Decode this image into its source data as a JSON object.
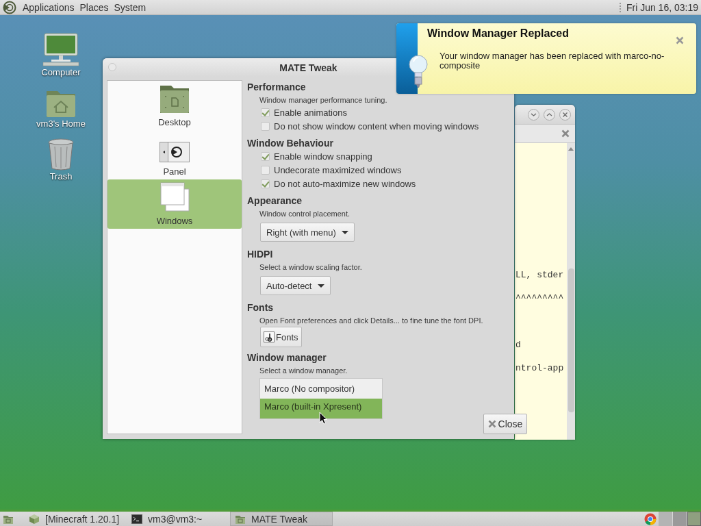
{
  "top_panel": {
    "menus": [
      "Applications",
      "Places",
      "System"
    ],
    "clock": "Fri Jun 16, 03:19"
  },
  "desktop_icons": [
    {
      "label": "Computer",
      "kind": "computer"
    },
    {
      "label": "vm3's Home",
      "kind": "home"
    },
    {
      "label": "Trash",
      "kind": "trash"
    }
  ],
  "background_window": {
    "text_lines": [
      "LL, stder",
      "^^^^^^^^^",
      "d",
      "ntrol-app"
    ]
  },
  "tweak_window": {
    "title": "MATE Tweak",
    "sidebar": [
      {
        "label": "Desktop",
        "kind": "desktop",
        "selected": false
      },
      {
        "label": "Panel",
        "kind": "panel",
        "selected": false
      },
      {
        "label": "Windows",
        "kind": "windows",
        "selected": true
      }
    ],
    "sections": [
      {
        "heading": "Performance",
        "description": "Window manager performance tuning.",
        "kind": "checks",
        "options": [
          {
            "label": "Enable animations",
            "checked": true
          },
          {
            "label": "Do not show window content when moving windows",
            "checked": false
          }
        ]
      },
      {
        "heading": "Window Behaviour",
        "kind": "checks",
        "options": [
          {
            "label": "Enable window snapping",
            "checked": true
          },
          {
            "label": "Undecorate maximized windows",
            "checked": false
          },
          {
            "label": "Do not auto-maximize new windows",
            "checked": true
          }
        ]
      },
      {
        "heading": "Appearance",
        "description": "Window control placement.",
        "kind": "dropdown",
        "value": "Right (with menu)"
      },
      {
        "heading": "HIDPI",
        "description": "Select a window scaling factor.",
        "kind": "dropdown",
        "value": "Auto-detect"
      },
      {
        "heading": "Fonts",
        "description": "Open Font preferences and click Details... to fine tune the font DPI.",
        "kind": "button",
        "button": "Fonts"
      },
      {
        "heading": "Window manager",
        "description": "Select a window manager.",
        "kind": "list",
        "options": [
          {
            "label": "Marco (No compositor)",
            "selected": false
          },
          {
            "label": "Marco (built-in Xpresent)",
            "selected": true
          }
        ]
      }
    ],
    "close_button": "Close"
  },
  "notification": {
    "title": "Window Manager Replaced",
    "body": "Your window manager has been replaced with marco-no-composite"
  },
  "taskbar": {
    "items": [
      {
        "label": "[Minecraft 1.20.1]",
        "kind": "cube",
        "selected": false
      },
      {
        "label": "vm3@vm3:~",
        "kind": "terminal",
        "selected": false
      },
      {
        "label": "MATE Tweak",
        "kind": "tweak",
        "selected": true
      }
    ]
  }
}
